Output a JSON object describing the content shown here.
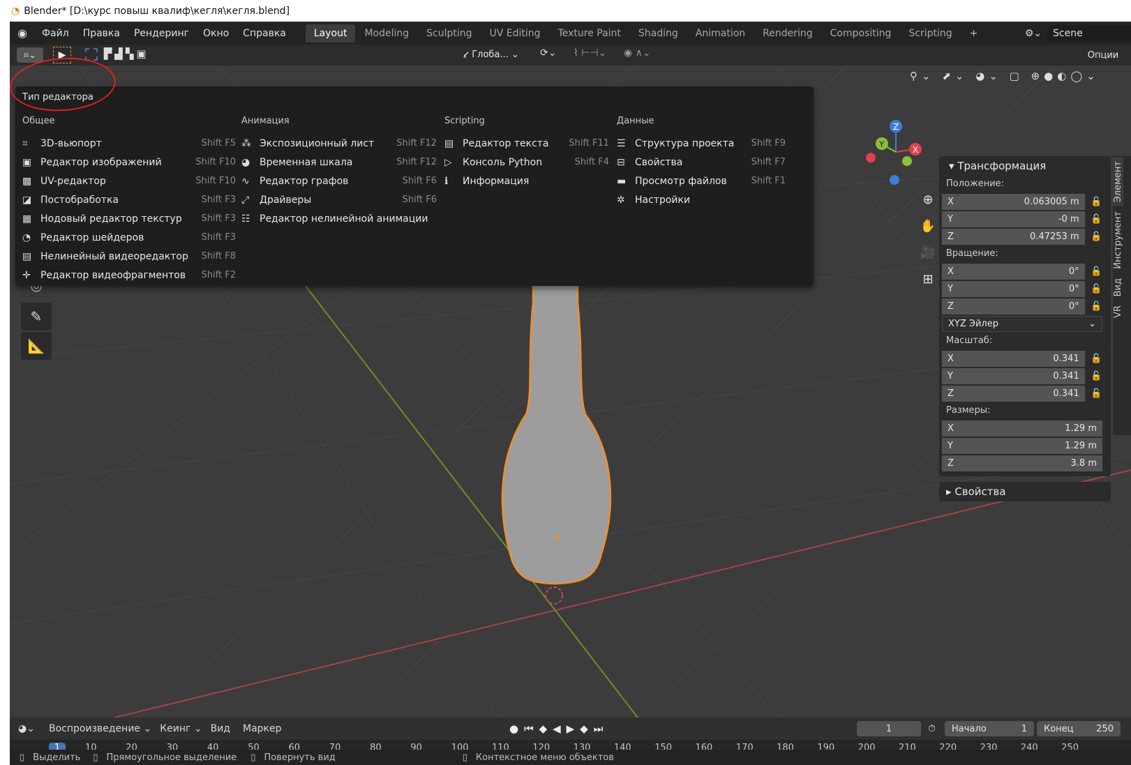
{
  "window": {
    "title": "Blender* [D:\\курс повыш квалиф\\кегля\\кегля.blend]"
  },
  "menu": [
    "Файл",
    "Правка",
    "Рендеринг",
    "Окно",
    "Справка"
  ],
  "workspace_tabs": [
    "Layout",
    "Modeling",
    "Sculpting",
    "UV Editing",
    "Texture Paint",
    "Shading",
    "Animation",
    "Rendering",
    "Compositing",
    "Scripting"
  ],
  "active_tab": "Layout",
  "scene": {
    "name": "Scene"
  },
  "header2": {
    "orientation": "Глоба...",
    "options": "Опции"
  },
  "editor_type_menu": {
    "title": "Тип редактора",
    "columns": [
      {
        "heading": "Общее",
        "items": [
          {
            "label": "3D-вьюпорт",
            "shortcut": "Shift F5",
            "icon": "viewport-3d-icon"
          },
          {
            "label": "Редактор изображений",
            "shortcut": "Shift F10",
            "icon": "image-editor-icon"
          },
          {
            "label": "UV-редактор",
            "shortcut": "Shift F10",
            "icon": "uv-editor-icon"
          },
          {
            "label": "Постобработка",
            "shortcut": "Shift F3",
            "icon": "compositor-icon"
          },
          {
            "label": "Нодовый редактор текстур",
            "shortcut": "Shift F3",
            "icon": "texture-node-icon"
          },
          {
            "label": "Редактор шейдеров",
            "shortcut": "Shift F3",
            "icon": "shader-editor-icon"
          },
          {
            "label": "Нелинейный видеоредактор",
            "shortcut": "Shift F8",
            "icon": "sequencer-icon"
          },
          {
            "label": "Редактор видеофрагментов",
            "shortcut": "Shift F2",
            "icon": "clip-editor-icon"
          }
        ]
      },
      {
        "heading": "Анимация",
        "items": [
          {
            "label": "Экспозиционный лист",
            "shortcut": "Shift F12",
            "icon": "dopesheet-icon"
          },
          {
            "label": "Временная шкала",
            "shortcut": "Shift F12",
            "icon": "timeline-icon"
          },
          {
            "label": "Редактор графов",
            "shortcut": "Shift F6",
            "icon": "graph-editor-icon"
          },
          {
            "label": "Драйверы",
            "shortcut": "Shift F6",
            "icon": "drivers-icon"
          },
          {
            "label": "Редактор нелинейной анимации",
            "shortcut": "",
            "icon": "nla-icon"
          }
        ]
      },
      {
        "heading": "Scripting",
        "items": [
          {
            "label": "Редактор текста",
            "shortcut": "Shift F11",
            "icon": "text-editor-icon"
          },
          {
            "label": "Консоль Python",
            "shortcut": "Shift F4",
            "icon": "console-icon"
          },
          {
            "label": "Информация",
            "shortcut": "",
            "icon": "info-icon"
          }
        ]
      },
      {
        "heading": "Данные",
        "items": [
          {
            "label": "Структура проекта",
            "shortcut": "Shift F9",
            "icon": "outliner-icon"
          },
          {
            "label": "Свойства",
            "shortcut": "Shift F7",
            "icon": "properties-icon"
          },
          {
            "label": "Просмотр файлов",
            "shortcut": "Shift F1",
            "icon": "file-browser-icon"
          },
          {
            "label": "Настройки",
            "shortcut": "",
            "icon": "preferences-icon"
          }
        ]
      }
    ]
  },
  "transform_panel": {
    "title": "Трансформация",
    "location_label": "Положение:",
    "location": [
      {
        "axis": "X",
        "value": "0.063005 m"
      },
      {
        "axis": "Y",
        "value": "-0 m"
      },
      {
        "axis": "Z",
        "value": "0.47253 m"
      }
    ],
    "rotation_label": "Вращение:",
    "rotation": [
      {
        "axis": "X",
        "value": "0°"
      },
      {
        "axis": "Y",
        "value": "0°"
      },
      {
        "axis": "Z",
        "value": "0°"
      }
    ],
    "rotation_mode": "XYZ Эйлер",
    "scale_label": "Масштаб:",
    "scale": [
      {
        "axis": "X",
        "value": "0.341"
      },
      {
        "axis": "Y",
        "value": "0.341"
      },
      {
        "axis": "Z",
        "value": "0.341"
      }
    ],
    "dimensions_label": "Размеры:",
    "dimensions": [
      {
        "axis": "X",
        "value": "1.29 m"
      },
      {
        "axis": "Y",
        "value": "1.29 m"
      },
      {
        "axis": "Z",
        "value": "3.8 m"
      }
    ],
    "properties_label": "Свойства"
  },
  "side_tabs": [
    "Элемент",
    "Инструмент",
    "Вид",
    "VR"
  ],
  "timeline": {
    "menus": [
      "Воспроизведение",
      "Кеинг",
      "Вид",
      "Маркер"
    ],
    "current_frame": "1",
    "start_label": "Начало",
    "start": "1",
    "end_label": "Конец",
    "end": "250",
    "ticks": [
      "1",
      "10",
      "20",
      "30",
      "40",
      "50",
      "60",
      "70",
      "80",
      "90",
      "100",
      "110",
      "120",
      "130",
      "140",
      "150",
      "160",
      "170",
      "180",
      "190",
      "200",
      "210",
      "220",
      "230",
      "240",
      "250"
    ]
  },
  "status_bar": [
    "Выделить",
    "Прямоугольное выделение",
    "Повернуть вид",
    "Контекстное меню объектов"
  ],
  "colors": {
    "accent": "#4772b3",
    "selection": "#e8891a",
    "x_axis": "#e04050",
    "y_axis": "#8ac03c",
    "z_axis": "#3c7fd8"
  }
}
